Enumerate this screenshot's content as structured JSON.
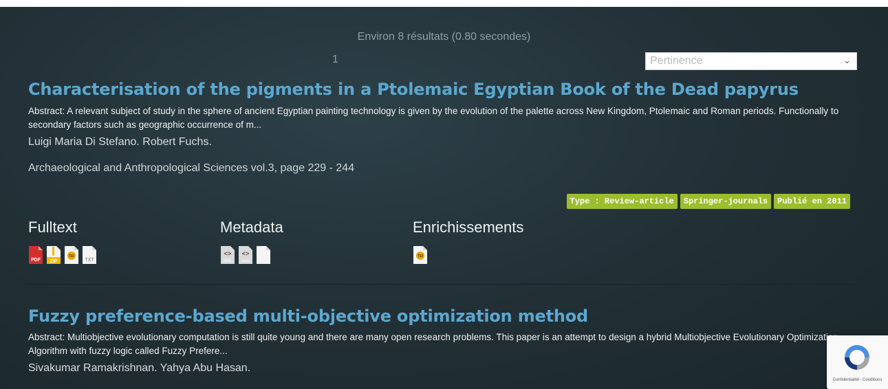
{
  "search": {
    "results_info": "Environ 8 résultats (0.80 secondes)",
    "page": "1",
    "sort": {
      "selected": "Pertinence",
      "icon": "chevron-down-icon"
    }
  },
  "results": [
    {
      "title": "Characterisation of the pigments in a Ptolemaic Egyptian Book of the Dead papyrus",
      "abstract": "Abstract: A relevant subject of study in the sphere of ancient Egyptian painting technology is given by the evolution of the palette across New Kingdom, Ptolemaic and Roman periods. Functionally to secondary factors such as geographic occurrence of m...",
      "authors": "Luigi Maria Di Stefano. Robert Fuchs.",
      "journal": "Archaeological and Anthropological Sciences vol.3, page 229 - 244",
      "badges": [
        "Type : Review-article",
        "Springer-journals",
        "Publié en 2011"
      ],
      "sections": {
        "fulltext": {
          "label": "Fulltext",
          "icons": [
            "PDF",
            "ZIP",
            "TEI",
            "TXT"
          ]
        },
        "metadata": {
          "label": "Metadata",
          "icons": [
            "XML",
            "MODS"
          ]
        },
        "enrichments": {
          "label": "Enrichissements",
          "icons": [
            "TEI"
          ]
        }
      }
    },
    {
      "title": "Fuzzy preference-based multi-objective optimization method",
      "abstract": "Abstract: Multiobjective evolutionary computation is still quite young and there are many open research problems. This paper is an attempt to design a hybrid Multiobjective Evolutionary Optimization Algorithm with fuzzy logic called Fuzzy Prefere...",
      "authors": "Sivakumar Ramakrishnan. Yahya Abu Hasan."
    }
  ],
  "recaptcha": {
    "text": "Confidentialité - Conditions"
  },
  "colors": {
    "title": "#5ba8d0",
    "badge": "#9cbd2e",
    "background": "#233238"
  }
}
